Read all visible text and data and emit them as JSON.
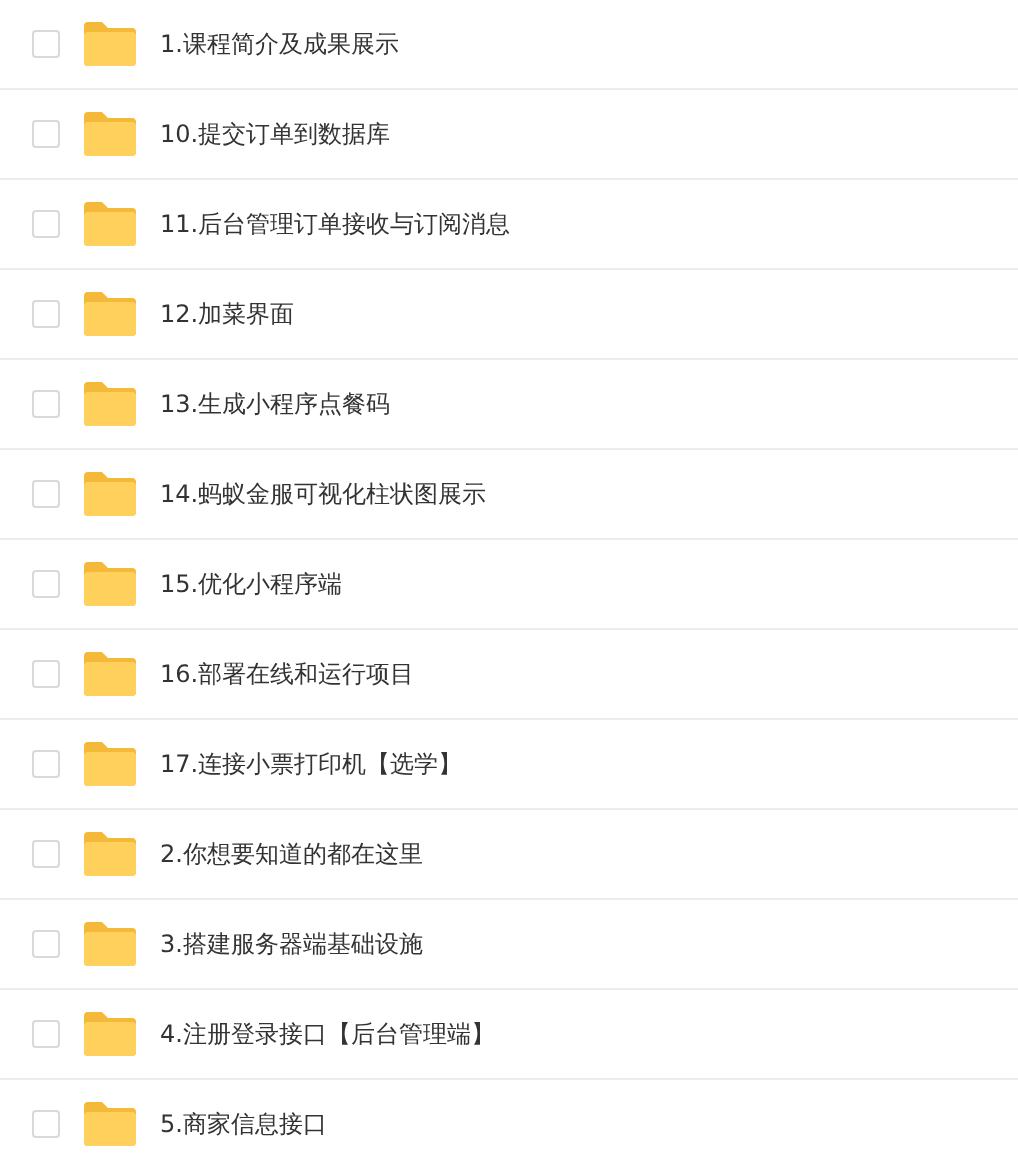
{
  "items": [
    {
      "title": "1.课程简介及成果展示",
      "checked": false
    },
    {
      "title": "10.提交订单到数据库",
      "checked": false
    },
    {
      "title": "11.后台管理订单接收与订阅消息",
      "checked": false
    },
    {
      "title": "12.加菜界面",
      "checked": false
    },
    {
      "title": "13.生成小程序点餐码",
      "checked": false
    },
    {
      "title": "14.蚂蚁金服可视化柱状图展示",
      "checked": false
    },
    {
      "title": "15.优化小程序端",
      "checked": false
    },
    {
      "title": "16.部署在线和运行项目",
      "checked": false
    },
    {
      "title": "17.连接小票打印机【选学】",
      "checked": false
    },
    {
      "title": "2.你想要知道的都在这里",
      "checked": false
    },
    {
      "title": "3.搭建服务器端基础设施",
      "checked": false
    },
    {
      "title": "4.注册登录接口【后台管理端】",
      "checked": false
    },
    {
      "title": "5.商家信息接口",
      "checked": false
    }
  ]
}
